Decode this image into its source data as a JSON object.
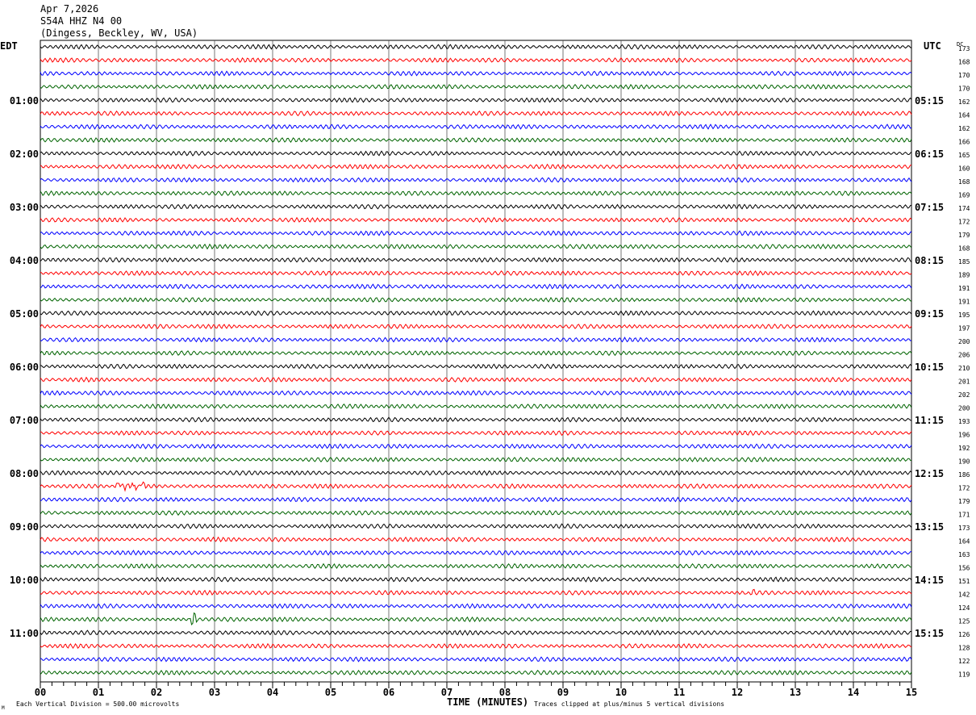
{
  "header": {
    "date": "Apr 7,2026",
    "station": "S54A HHZ N4 00",
    "location": "(Dingess, Beckley, WV, USA)"
  },
  "left_timezone": "EDT",
  "right_timezone": "UTC",
  "dc_header": "DC",
  "footer": {
    "scale_note": "Each Vertical Division =  500.00 microvolts",
    "clip_note": "Traces clipped at plus/minus 5 vertical divisions",
    "corner_mark": "M"
  },
  "chart_data": {
    "type": "line",
    "title": "",
    "xlabel": "TIME (MINUTES)",
    "xlim": [
      0,
      15
    ],
    "x_ticks": [
      "00",
      "01",
      "02",
      "03",
      "04",
      "05",
      "06",
      "07",
      "08",
      "09",
      "10",
      "11",
      "12",
      "13",
      "14",
      "15"
    ],
    "grid": true,
    "trace_colors": [
      "#000000",
      "#ff0000",
      "#0000ff",
      "#006400"
    ],
    "left_hour_labels": [
      "01:00",
      "02:00",
      "03:00",
      "04:00",
      "05:00",
      "06:00",
      "07:00",
      "08:00",
      "09:00",
      "10:00",
      "11:00"
    ],
    "right_hour_labels": [
      "05:15",
      "06:15",
      "07:15",
      "08:15",
      "09:15",
      "10:15",
      "11:15",
      "12:15",
      "13:15",
      "14:15",
      "15:15"
    ],
    "dc_offsets": [
      173,
      168,
      170,
      170,
      162,
      164,
      162,
      166,
      165,
      160,
      168,
      169,
      174,
      172,
      179,
      168,
      185,
      189,
      191,
      191,
      195,
      197,
      200,
      206,
      210,
      201,
      202,
      200,
      193,
      196,
      192,
      190,
      186,
      172,
      179,
      171,
      173,
      164,
      163,
      156,
      151,
      142,
      124,
      125,
      126,
      128,
      122,
      119
    ],
    "events": [
      {
        "trace_index": 33,
        "minute_start": 1.3,
        "minute_end": 1.8,
        "amplitude": "moderate"
      },
      {
        "trace_index": 43,
        "minute_start": 2.55,
        "minute_end": 2.7,
        "amplitude": "large"
      },
      {
        "trace_index": 41,
        "minute_start": 12.15,
        "minute_end": 12.3,
        "amplitude": "small"
      }
    ]
  }
}
